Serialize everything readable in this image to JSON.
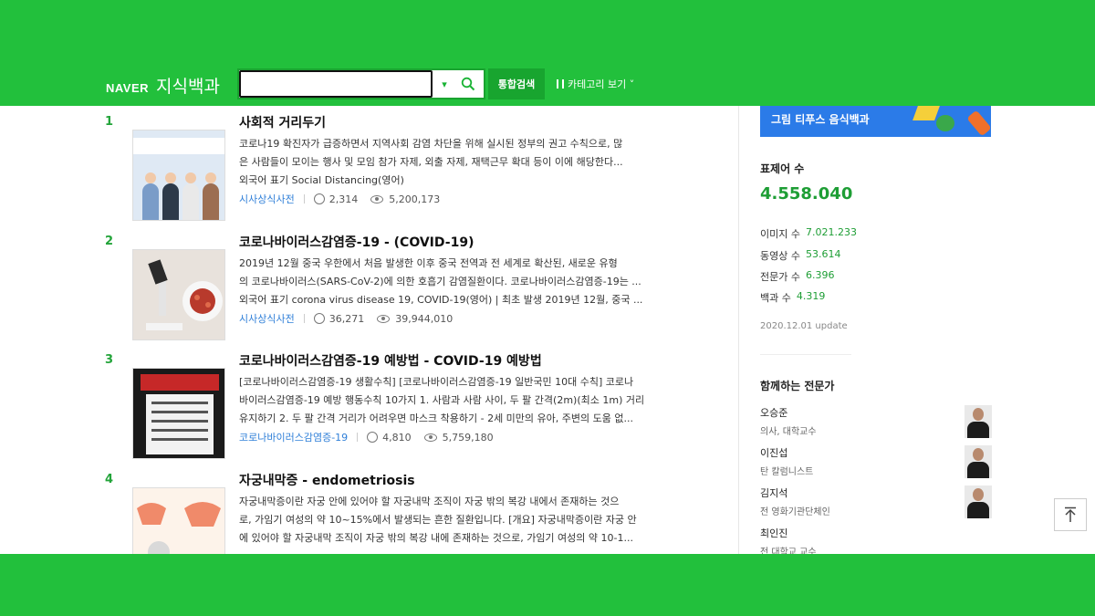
{
  "header": {
    "logo_brand": "NAVER",
    "logo_service": "지식백과",
    "search_placeholder": "",
    "search_dropdown_glyph": "▾",
    "total_search_label": "통합검색",
    "category_label": "카테고리 보기 ˅"
  },
  "results": [
    {
      "rank": "1",
      "title": "사회적 거리두기",
      "desc": [
        "코로나19 확진자가 급증하면서 지역사회 감염 차단을 위해 실시된 정부의 권고 수칙으로, 많",
        "은 사람들이 모이는 행사 및 모임 참가 자제, 외출 자제, 재택근무 확대 등이 이에 해당한다...",
        "외국어 표기 Social Distancing(영어)"
      ],
      "source": "시사상식사전",
      "likes": "2,314",
      "views": "5,200,173"
    },
    {
      "rank": "2",
      "title": "코로나바이러스감염증-19 - (COVID-19)",
      "desc": [
        "2019년 12월 중국 우한에서 처음 발생한 이후 중국 전역과 전 세계로 확산된, 새로운 유형",
        "의 코로나바이러스(SARS-CoV-2)에 의한 호흡기 감염질환이다. 코로나바이러스감염증-19는 ...",
        "외국어 표기 corona virus disease 19, COVID-19(영어) | 최초 발생 2019년 12월, 중국 ..."
      ],
      "source": "시사상식사전",
      "likes": "36,271",
      "views": "39,944,010"
    },
    {
      "rank": "3",
      "title": "코로나바이러스감염증-19 예방법 - COVID-19 예방법",
      "desc": [
        "[코로나바이러스감염증-19 생활수칙] [코로나바이러스감염증-19 일반국민 10대 수칙] 코로나",
        "바이러스감염증-19 예방 행동수칙 10가지 1. 사람과 사람 사이, 두 팔 간격(2m)(최소 1m) 거리",
        "유지하기 2. 두 팔 간격 거리가 어려우면 마스크 착용하기 - 2세 미만의 유아, 주변의 도움 없..."
      ],
      "source": "코로나바이러스감염증-19",
      "likes": "4,810",
      "views": "5,759,180"
    },
    {
      "rank": "4",
      "title": "자궁내막증 - endometriosis",
      "desc": [
        "자궁내막증이란 자궁 안에 있어야 할 자궁내막 조직이 자궁 밖의 복강 내에서 존재하는 것으",
        "로, 가임기 여성의 약 10~15%에서 발생되는 흔한 질환입니다. [개요] 자궁내막증이란 자궁 안",
        "에 있어야 할 자궁내막 조직이 자궁 밖의 복강 내에 존재하는 것으로, 가임기 여성의 약 10-1..."
      ],
      "source": "",
      "likes": "",
      "views": ""
    }
  ],
  "sidebar": {
    "banner_text": "그림 티푸스 음식백과",
    "stats_title": "표제어 수",
    "stats_total": "4.558.040",
    "stats": [
      {
        "label": "이미지 수",
        "value": "7.021.233"
      },
      {
        "label": "동영상 수",
        "value": "53.614"
      },
      {
        "label": "전문가 수",
        "value": "6.396"
      },
      {
        "label": "백과 수",
        "value": "4.319"
      }
    ],
    "update_text": "2020.12.01 update",
    "experts_title": "함께하는 전문가",
    "experts": [
      {
        "name": "오승준",
        "role": "의사, 대학교수"
      },
      {
        "name": "이진섭",
        "role": "탄 칼럼니스트"
      },
      {
        "name": "김지석",
        "role": "전 영화기관단체인"
      },
      {
        "name": "최인진",
        "role": "전 대학교 교수"
      }
    ]
  },
  "colors": {
    "brand_green": "#22c03c",
    "rank_green": "#23a43a",
    "link_blue": "#2f7fd8"
  }
}
